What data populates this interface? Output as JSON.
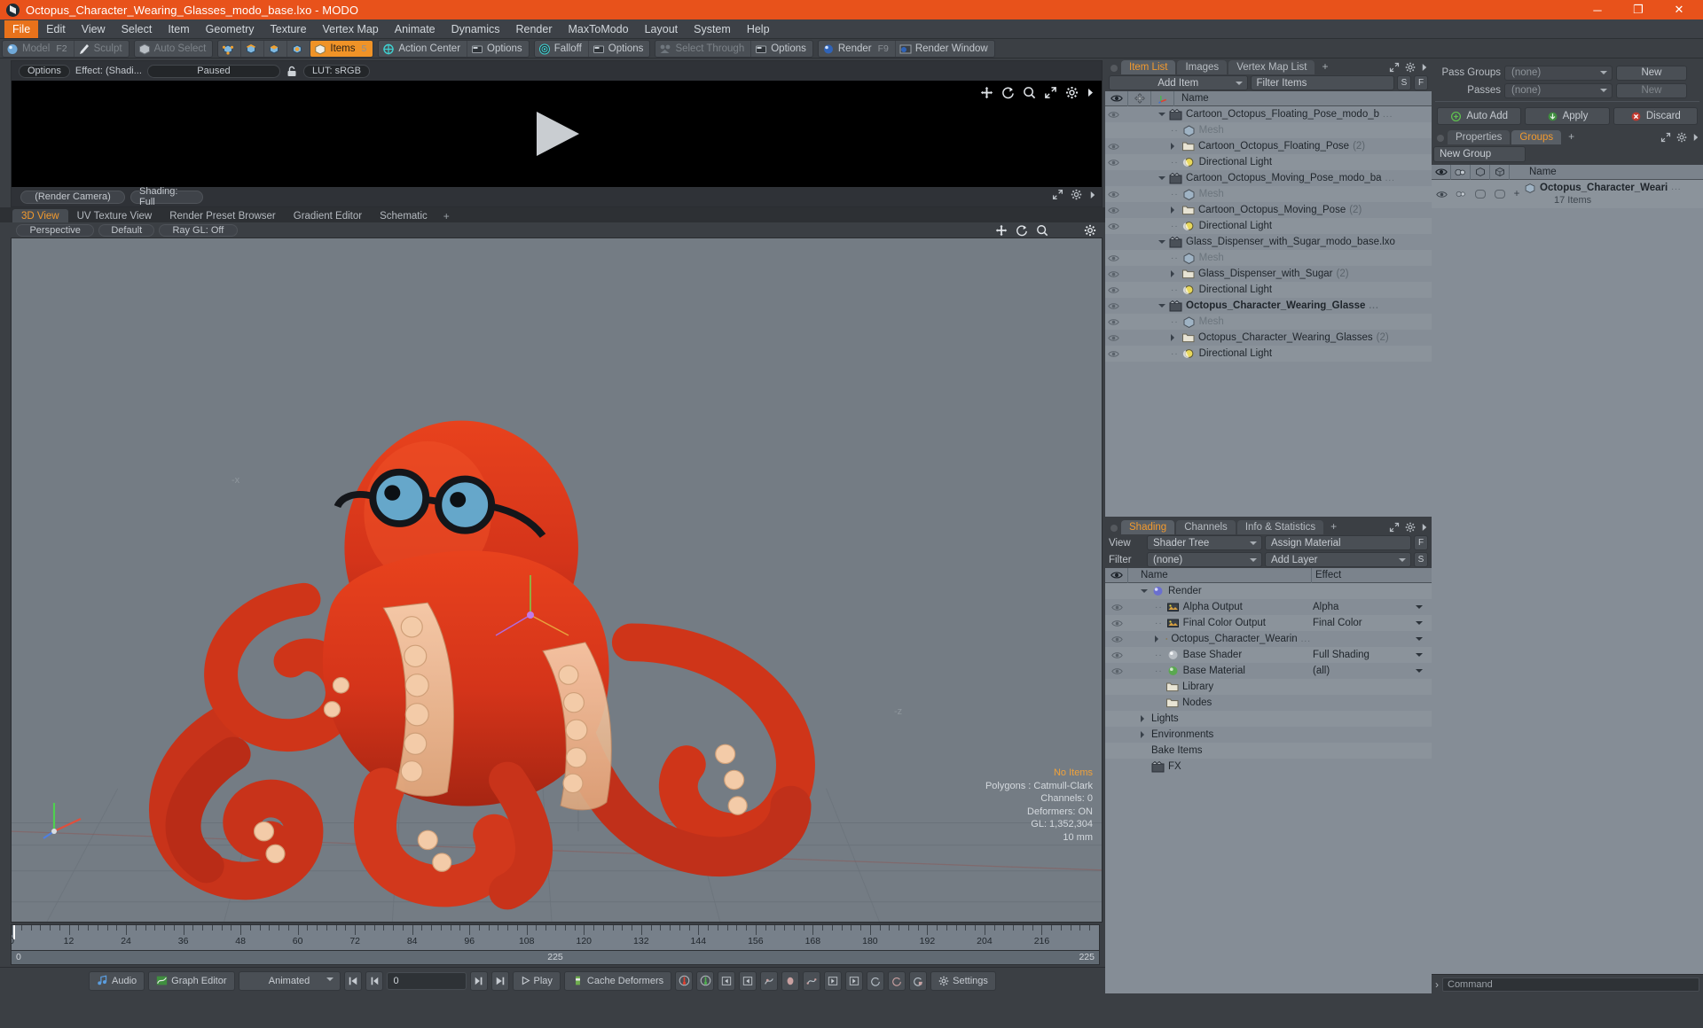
{
  "window": {
    "title": "Octopus_Character_Wearing_Glasses_modo_base.lxo - MODO",
    "minimize": "─",
    "maximize": "❐",
    "close": "✕",
    "accent": "#e8521b"
  },
  "menu": [
    "File",
    "Edit",
    "View",
    "Select",
    "Item",
    "Geometry",
    "Texture",
    "Vertex Map",
    "Animate",
    "Dynamics",
    "Render",
    "MaxToModo",
    "Layout",
    "System",
    "Help"
  ],
  "menu_active": "File",
  "toolbar": {
    "groups": [
      {
        "items": [
          {
            "label": "Model",
            "key": "F2",
            "icon": "sphere-icon",
            "state": "dim"
          },
          {
            "label": "Sculpt",
            "key": "",
            "icon": "brush-icon",
            "state": "dim"
          }
        ]
      },
      {
        "items": [
          {
            "label": "Auto Select",
            "key": "",
            "icon": "cube-icon",
            "state": "dim"
          }
        ]
      },
      {
        "items": [
          {
            "label": "",
            "key": "",
            "icon": "vertex-icon",
            "state": "icon"
          },
          {
            "label": "",
            "key": "",
            "icon": "edge-icon",
            "state": "icon"
          },
          {
            "label": "",
            "key": "",
            "icon": "polygon-icon",
            "state": "icon"
          },
          {
            "label": "",
            "key": "",
            "icon": "material-icon",
            "state": "icon"
          },
          {
            "label": "Items",
            "key": "5",
            "icon": "items-icon",
            "state": "on"
          }
        ]
      },
      {
        "items": [
          {
            "label": "Action Center",
            "key": "",
            "icon": "target-icon",
            "state": "normal"
          },
          {
            "label": "Options",
            "key": "",
            "icon": "options-icon",
            "state": "normal"
          }
        ]
      },
      {
        "items": [
          {
            "label": "Falloff",
            "key": "",
            "icon": "falloff-icon",
            "state": "normal"
          },
          {
            "label": "Options",
            "key": "",
            "icon": "options-icon",
            "state": "normal"
          }
        ]
      },
      {
        "items": [
          {
            "label": "Select Through",
            "key": "",
            "icon": "select-through-icon",
            "state": "dim"
          },
          {
            "label": "Options",
            "key": "",
            "icon": "options-icon",
            "state": "normal"
          }
        ]
      },
      {
        "items": [
          {
            "label": "Render",
            "key": "F9",
            "icon": "render-icon",
            "state": "normal"
          },
          {
            "label": "Render Window",
            "key": "",
            "icon": "render-window-icon",
            "state": "normal"
          }
        ]
      }
    ]
  },
  "render_preview": {
    "options_label": "Options",
    "effect_label": "Effect: (Shadi...",
    "status_label": "Paused",
    "lock_icon": "unlock-icon",
    "lut_label": "LUT: sRGB",
    "camera_label": "(Render Camera)",
    "shading_label": "Shading: Full",
    "play_icon": "play-triangle-icon",
    "icons": [
      "pan-icon",
      "rotate-icon",
      "zoom-icon",
      "fit-icon",
      "gear-icon",
      "chevron-right-icon"
    ]
  },
  "viewport": {
    "tabs": [
      {
        "label": "3D View",
        "selected": true
      },
      {
        "label": "UV Texture View",
        "selected": false
      },
      {
        "label": "Render Preset Browser",
        "selected": false
      },
      {
        "label": "Gradient Editor",
        "selected": false
      },
      {
        "label": "Schematic",
        "selected": false
      }
    ],
    "tab_add": "+",
    "controls": [
      "Perspective",
      "Default",
      "Ray GL: Off"
    ],
    "icons": [
      "pan-icon",
      "rotate-icon",
      "zoom-icon",
      "gear-icon"
    ],
    "axis_labels": [
      "-x",
      "-z"
    ],
    "stats": {
      "selection": "No Items",
      "polygons": "Polygons : Catmull-Clark",
      "channels": "Channels: 0",
      "deformers": "Deformers: ON",
      "gl": "GL: 1,352,304",
      "scale": "10 mm"
    }
  },
  "timeline": {
    "ticks": [
      0,
      12,
      24,
      36,
      48,
      60,
      72,
      84,
      96,
      108,
      120,
      132,
      144,
      156,
      168,
      180,
      192,
      204,
      216
    ],
    "range_start": "0",
    "range_end": "225",
    "range_center": "225",
    "current_frame": "0"
  },
  "bottombar": {
    "audio": "Audio",
    "graph_editor": "Graph Editor",
    "mode": "Animated",
    "frame_value": "0",
    "play": "Play",
    "cache_deformers": "Cache Deformers",
    "settings": "Settings",
    "transport": [
      "go-start-icon",
      "step-back-icon",
      "step-forward-icon",
      "go-end-icon"
    ],
    "tool_icons": [
      "key-red-icon",
      "key-green-icon",
      "prev-key-icon",
      "prev-key2-icon",
      "curve-icon",
      "ellipse-icon",
      "graph-icon",
      "next-key-icon",
      "next-key2-icon",
      "cycle-icon",
      "cycle2-icon",
      "cycle3-icon"
    ]
  },
  "item_list": {
    "tabs": [
      {
        "label": "Item List",
        "selected": true
      },
      {
        "label": "Images",
        "selected": false
      },
      {
        "label": "Vertex Map List",
        "selected": false
      }
    ],
    "tab_add": "+",
    "add_item": "Add Item",
    "filter_items": "Filter Items",
    "btn_s": "S",
    "btn_f": "F",
    "columns": [
      "eye-icon",
      "move-icon",
      "axis-icon",
      "Name"
    ],
    "rows": [
      {
        "indent": 0,
        "toggle": "down",
        "icon": "scene-icon",
        "name": "Cartoon_Octopus_Floating_Pose_modo_b",
        "ellipsis": "...",
        "count": "",
        "dim": false,
        "bold": false,
        "eye": true
      },
      {
        "indent": 1,
        "toggle": "dots",
        "icon": "mesh-icon",
        "name": "Mesh",
        "count": "",
        "dim": true,
        "bold": false,
        "eye": false
      },
      {
        "indent": 1,
        "toggle": "right",
        "icon": "folder-icon",
        "name": "Cartoon_Octopus_Floating_Pose",
        "count": "(2)",
        "dim": false,
        "bold": false,
        "eye": true
      },
      {
        "indent": 1,
        "toggle": "dots",
        "icon": "light-icon",
        "name": "Directional Light",
        "count": "",
        "dim": false,
        "bold": false,
        "eye": true
      },
      {
        "indent": 0,
        "toggle": "down",
        "icon": "scene-icon",
        "name": "Cartoon_Octopus_Moving_Pose_modo_ba",
        "ellipsis": "...",
        "count": "",
        "dim": false,
        "bold": false,
        "eye": false
      },
      {
        "indent": 1,
        "toggle": "dots",
        "icon": "mesh-icon",
        "name": "Mesh",
        "count": "",
        "dim": true,
        "bold": false,
        "eye": true
      },
      {
        "indent": 1,
        "toggle": "right",
        "icon": "folder-icon",
        "name": "Cartoon_Octopus_Moving_Pose",
        "count": "(2)",
        "dim": false,
        "bold": false,
        "eye": true
      },
      {
        "indent": 1,
        "toggle": "dots",
        "icon": "light-icon",
        "name": "Directional Light",
        "count": "",
        "dim": false,
        "bold": false,
        "eye": true
      },
      {
        "indent": 0,
        "toggle": "down",
        "icon": "scene-icon",
        "name": "Glass_Dispenser_with_Sugar_modo_base.lxo",
        "count": "",
        "dim": false,
        "bold": false,
        "eye": false
      },
      {
        "indent": 1,
        "toggle": "dots",
        "icon": "mesh-icon",
        "name": "Mesh",
        "count": "",
        "dim": true,
        "bold": false,
        "eye": true
      },
      {
        "indent": 1,
        "toggle": "right",
        "icon": "folder-icon",
        "name": "Glass_Dispenser_with_Sugar",
        "count": "(2)",
        "dim": false,
        "bold": false,
        "eye": true
      },
      {
        "indent": 1,
        "toggle": "dots",
        "icon": "light-icon",
        "name": "Directional Light",
        "count": "",
        "dim": false,
        "bold": false,
        "eye": true
      },
      {
        "indent": 0,
        "toggle": "down",
        "icon": "scene-icon",
        "name": "Octopus_Character_Wearing_Glasse",
        "ellipsis": "...",
        "count": "",
        "dim": false,
        "bold": true,
        "eye": true
      },
      {
        "indent": 1,
        "toggle": "dots",
        "icon": "mesh-icon",
        "name": "Mesh",
        "count": "",
        "dim": true,
        "bold": false,
        "eye": true
      },
      {
        "indent": 1,
        "toggle": "right",
        "icon": "folder-icon",
        "name": "Octopus_Character_Wearing_Glasses",
        "count": "(2)",
        "dim": false,
        "bold": false,
        "eye": true
      },
      {
        "indent": 1,
        "toggle": "dots",
        "icon": "light-icon",
        "name": "Directional Light",
        "count": "",
        "dim": false,
        "bold": false,
        "eye": true
      }
    ]
  },
  "shading": {
    "tabs": [
      {
        "label": "Shading",
        "selected": true
      },
      {
        "label": "Channels",
        "selected": false
      },
      {
        "label": "Info & Statistics",
        "selected": false
      }
    ],
    "tab_add": "+",
    "view_label": "View",
    "view_value": "Shader Tree",
    "assign_material": "Assign Material",
    "btn_f": "F",
    "filter_label": "Filter",
    "filter_value": "(none)",
    "add_layer": "Add Layer",
    "btn_s": "S",
    "columns": [
      "eye-icon",
      "Name",
      "Effect"
    ],
    "rows": [
      {
        "indent": 0,
        "toggle": "down",
        "icon": "render-sphere-icon",
        "name": "Render",
        "effect": "",
        "eye": false
      },
      {
        "indent": 1,
        "toggle": "dots",
        "icon": "image-icon",
        "name": "Alpha Output",
        "effect": "Alpha",
        "eye": true
      },
      {
        "indent": 1,
        "toggle": "dots",
        "icon": "image-icon",
        "name": "Final Color Output",
        "effect": "Final Color",
        "eye": true
      },
      {
        "indent": 1,
        "toggle": "right",
        "icon": "material-red-icon",
        "name": "Octopus_Character_Wearin",
        "ellipsis": "...",
        "effect": "",
        "eye": true
      },
      {
        "indent": 1,
        "toggle": "dots",
        "icon": "shader-icon",
        "name": "Base Shader",
        "effect": "Full Shading",
        "eye": true
      },
      {
        "indent": 1,
        "toggle": "dots",
        "icon": "material-green-icon",
        "name": "Base Material",
        "effect": "(all)",
        "eye": true
      },
      {
        "indent": 1,
        "toggle": "none",
        "icon": "folder-icon",
        "name": "Library",
        "effect": "",
        "eye": false
      },
      {
        "indent": 1,
        "toggle": "none",
        "icon": "folder-icon",
        "name": "Nodes",
        "effect": "",
        "eye": false
      },
      {
        "indent": 0,
        "toggle": "right",
        "icon": "none",
        "name": "Lights",
        "effect": "",
        "eye": false
      },
      {
        "indent": 0,
        "toggle": "right",
        "icon": "none",
        "name": "Environments",
        "effect": "",
        "eye": false
      },
      {
        "indent": 0,
        "toggle": "none",
        "icon": "none",
        "name": "Bake Items",
        "effect": "",
        "eye": false
      },
      {
        "indent": 0,
        "toggle": "none",
        "icon": "scene-icon",
        "name": "FX",
        "effect": "",
        "eye": false
      }
    ]
  },
  "passes": {
    "pass_groups_label": "Pass Groups",
    "pass_groups_value": "(none)",
    "pass_groups_new": "New",
    "passes_label": "Passes",
    "passes_value": "(none)",
    "passes_new": "New",
    "auto_add": "Auto Add",
    "apply": "Apply",
    "discard": "Discard"
  },
  "groups": {
    "tabs": [
      {
        "label": "Properties",
        "selected": false
      },
      {
        "label": "Groups",
        "selected": true
      }
    ],
    "tab_add": "+",
    "new_group": "New Group",
    "columns": [
      "eye-icon",
      "render-icon",
      "cube-icon",
      "cube2-icon",
      "Name"
    ],
    "row": {
      "plus": "+",
      "name": "Octopus_Character_Weari",
      "ellipsis": "...",
      "sub": "17 Items"
    }
  },
  "command": {
    "prompt": "›",
    "placeholder": "Command",
    "label": "Command"
  }
}
